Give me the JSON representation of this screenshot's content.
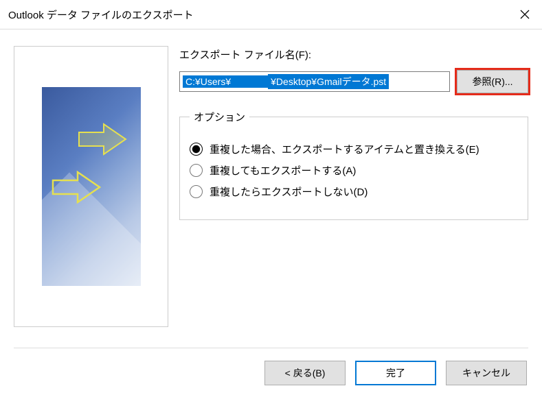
{
  "titlebar": {
    "title": "Outlook データ ファイルのエクスポート"
  },
  "main": {
    "filename_label": "エクスポート ファイル名(F):",
    "filepath_prefix": "C:¥Users¥",
    "filepath_suffix": "¥Desktop¥Gmailデータ.pst",
    "browse_label": "参照(R)..."
  },
  "options": {
    "legend": "オプション",
    "items": [
      {
        "label": "重複した場合、エクスポートするアイテムと置き換える(E)",
        "selected": true
      },
      {
        "label": "重複してもエクスポートする(A)",
        "selected": false
      },
      {
        "label": "重複したらエクスポートしない(D)",
        "selected": false
      }
    ]
  },
  "footer": {
    "back": "< 戻る(B)",
    "finish": "完了",
    "cancel": "キャンセル"
  }
}
